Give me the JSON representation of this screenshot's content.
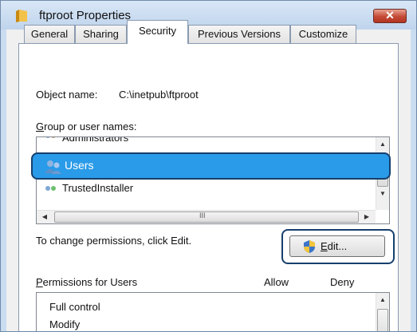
{
  "window": {
    "title": "ftproot Properties",
    "close_glyph": "✕"
  },
  "tabs": [
    "General",
    "Sharing",
    "Security",
    "Previous Versions",
    "Customize"
  ],
  "security": {
    "object_label": "Object name:",
    "object_value": "C:\\inetpub\\ftproot",
    "group_label_key": "G",
    "group_label_rest": "roup or user names:",
    "principals": [
      "Administrators",
      "Users",
      "TrustedInstaller"
    ],
    "selected_principal": "Users",
    "change_hint": "To change permissions, click Edit.",
    "edit_key": "E",
    "edit_rest": "dit...",
    "perm_label_key": "P",
    "perm_label_rest": "ermissions for Users",
    "allow_header": "Allow",
    "deny_header": "Deny",
    "permissions": [
      "Full control",
      "Modify"
    ]
  },
  "scroll_glyphs": {
    "up": "▲",
    "down": "▼",
    "left": "◀",
    "right": "▶",
    "grip": "III"
  },
  "colors": {
    "selection": "#3399ff",
    "highlight_border": "#163f6e"
  }
}
